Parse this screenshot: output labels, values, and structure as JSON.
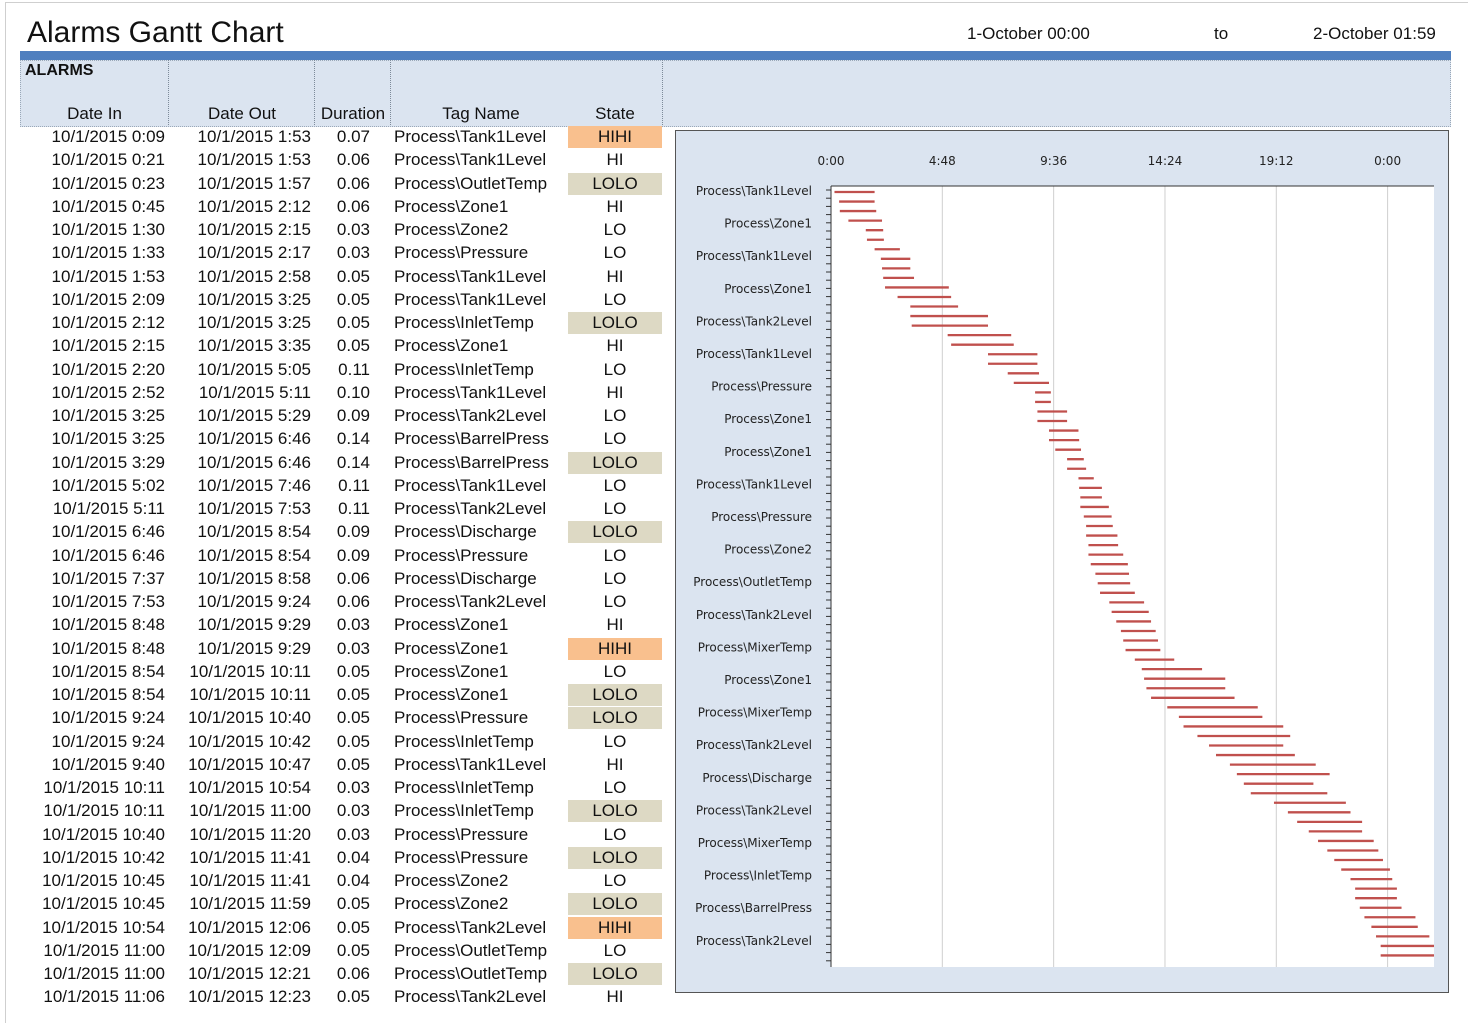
{
  "header": {
    "title": "Alarms Gantt Chart",
    "range_start": "1-October 00:00",
    "range_sep": "to",
    "range_end": "2-October 01:59"
  },
  "table": {
    "section_label": "ALARMS",
    "columns": [
      "Date In",
      "Date Out",
      "Duration",
      "Tag Name",
      "State"
    ],
    "state_colors": {
      "HIHI": "#f9c08e",
      "LOLO": "#ddd9c4",
      "HI": "#ffffff",
      "LO": "#ffffff"
    },
    "rows": [
      [
        "10/1/2015 0:09",
        "10/1/2015 1:53",
        "0.07",
        "Process\\Tank1Level",
        "HIHI"
      ],
      [
        "10/1/2015 0:21",
        "10/1/2015 1:53",
        "0.06",
        "Process\\Tank1Level",
        "HI"
      ],
      [
        "10/1/2015 0:23",
        "10/1/2015 1:57",
        "0.06",
        "Process\\OutletTemp",
        "LOLO"
      ],
      [
        "10/1/2015 0:45",
        "10/1/2015 2:12",
        "0.06",
        "Process\\Zone1",
        "HI"
      ],
      [
        "10/1/2015 1:30",
        "10/1/2015 2:15",
        "0.03",
        "Process\\Zone2",
        "LO"
      ],
      [
        "10/1/2015 1:33",
        "10/1/2015 2:17",
        "0.03",
        "Process\\Pressure",
        "LO"
      ],
      [
        "10/1/2015 1:53",
        "10/1/2015 2:58",
        "0.05",
        "Process\\Tank1Level",
        "HI"
      ],
      [
        "10/1/2015 2:09",
        "10/1/2015 3:25",
        "0.05",
        "Process\\Tank1Level",
        "LO"
      ],
      [
        "10/1/2015 2:12",
        "10/1/2015 3:25",
        "0.05",
        "Process\\InletTemp",
        "LOLO"
      ],
      [
        "10/1/2015 2:15",
        "10/1/2015 3:35",
        "0.05",
        "Process\\Zone1",
        "HI"
      ],
      [
        "10/1/2015 2:20",
        "10/1/2015 5:05",
        "0.11",
        "Process\\InletTemp",
        "LO"
      ],
      [
        "10/1/2015 2:52",
        "10/1/2015 5:11",
        "0.10",
        "Process\\Tank1Level",
        "HI"
      ],
      [
        "10/1/2015 3:25",
        "10/1/2015 5:29",
        "0.09",
        "Process\\Tank2Level",
        "LO"
      ],
      [
        "10/1/2015 3:25",
        "10/1/2015 6:46",
        "0.14",
        "Process\\BarrelPress",
        "LO"
      ],
      [
        "10/1/2015 3:29",
        "10/1/2015 6:46",
        "0.14",
        "Process\\BarrelPress",
        "LOLO"
      ],
      [
        "10/1/2015 5:02",
        "10/1/2015 7:46",
        "0.11",
        "Process\\Tank1Level",
        "LO"
      ],
      [
        "10/1/2015 5:11",
        "10/1/2015 7:53",
        "0.11",
        "Process\\Tank2Level",
        "LO"
      ],
      [
        "10/1/2015 6:46",
        "10/1/2015 8:54",
        "0.09",
        "Process\\Discharge",
        "LOLO"
      ],
      [
        "10/1/2015 6:46",
        "10/1/2015 8:54",
        "0.09",
        "Process\\Pressure",
        "LO"
      ],
      [
        "10/1/2015 7:37",
        "10/1/2015 8:58",
        "0.06",
        "Process\\Discharge",
        "LO"
      ],
      [
        "10/1/2015 7:53",
        "10/1/2015 9:24",
        "0.06",
        "Process\\Tank2Level",
        "LO"
      ],
      [
        "10/1/2015 8:48",
        "10/1/2015 9:29",
        "0.03",
        "Process\\Zone1",
        "HI"
      ],
      [
        "10/1/2015 8:48",
        "10/1/2015 9:29",
        "0.03",
        "Process\\Zone1",
        "HIHI"
      ],
      [
        "10/1/2015 8:54",
        "10/1/2015 10:11",
        "0.05",
        "Process\\Zone1",
        "LO"
      ],
      [
        "10/1/2015 8:54",
        "10/1/2015 10:11",
        "0.05",
        "Process\\Zone1",
        "LOLO"
      ],
      [
        "10/1/2015 9:24",
        "10/1/2015 10:40",
        "0.05",
        "Process\\Pressure",
        "LOLO"
      ],
      [
        "10/1/2015 9:24",
        "10/1/2015 10:42",
        "0.05",
        "Process\\InletTemp",
        "LO"
      ],
      [
        "10/1/2015 9:40",
        "10/1/2015 10:47",
        "0.05",
        "Process\\Tank1Level",
        "HI"
      ],
      [
        "10/1/2015 10:11",
        "10/1/2015 10:54",
        "0.03",
        "Process\\InletTemp",
        "LO"
      ],
      [
        "10/1/2015 10:11",
        "10/1/2015 11:00",
        "0.03",
        "Process\\InletTemp",
        "LOLO"
      ],
      [
        "10/1/2015 10:40",
        "10/1/2015 11:20",
        "0.03",
        "Process\\Pressure",
        "LO"
      ],
      [
        "10/1/2015 10:42",
        "10/1/2015 11:41",
        "0.04",
        "Process\\Pressure",
        "LOLO"
      ],
      [
        "10/1/2015 10:45",
        "10/1/2015 11:41",
        "0.04",
        "Process\\Zone2",
        "LO"
      ],
      [
        "10/1/2015 10:45",
        "10/1/2015 11:59",
        "0.05",
        "Process\\Zone2",
        "LOLO"
      ],
      [
        "10/1/2015 10:54",
        "10/1/2015 12:06",
        "0.05",
        "Process\\Tank2Level",
        "HIHI"
      ],
      [
        "10/1/2015 11:00",
        "10/1/2015 12:09",
        "0.05",
        "Process\\OutletTemp",
        "LO"
      ],
      [
        "10/1/2015 11:00",
        "10/1/2015 12:21",
        "0.06",
        "Process\\OutletTemp",
        "LOLO"
      ],
      [
        "10/1/2015 11:06",
        "10/1/2015 12:23",
        "0.05",
        "Process\\Tank2Level",
        "HI"
      ]
    ]
  },
  "chart_data": {
    "type": "gantt",
    "x_ticks": [
      "0:00",
      "4:48",
      "9:36",
      "14:24",
      "19:12",
      "0:00"
    ],
    "x_range_hours": [
      0,
      26
    ],
    "bar_color": "#c0504d",
    "y_labels": [
      "Process\\Tank1Level",
      "Process\\Zone1",
      "Process\\Tank1Level",
      "Process\\Zone1",
      "Process\\Tank2Level",
      "Process\\Tank1Level",
      "Process\\Pressure",
      "Process\\Zone1",
      "Process\\Zone1",
      "Process\\Tank1Level",
      "Process\\Pressure",
      "Process\\Zone2",
      "Process\\OutletTemp",
      "Process\\Tank2Level",
      "Process\\MixerTemp",
      "Process\\Zone1",
      "Process\\MixerTemp",
      "Process\\Tank2Level",
      "Process\\Discharge",
      "Process\\Tank2Level",
      "Process\\MixerTemp",
      "Process\\InletTemp",
      "Process\\BarrelPress",
      "Process\\Tank2Level"
    ],
    "bars_hours": [
      [
        0.15,
        1.88
      ],
      [
        0.35,
        1.88
      ],
      [
        0.38,
        1.95
      ],
      [
        0.75,
        2.2
      ],
      [
        1.5,
        2.25
      ],
      [
        1.55,
        2.28
      ],
      [
        1.88,
        2.97
      ],
      [
        2.15,
        3.42
      ],
      [
        2.2,
        3.42
      ],
      [
        2.25,
        3.58
      ],
      [
        2.33,
        5.08
      ],
      [
        2.87,
        5.18
      ],
      [
        3.42,
        5.48
      ],
      [
        3.42,
        6.77
      ],
      [
        3.48,
        6.77
      ],
      [
        5.03,
        7.77
      ],
      [
        5.18,
        7.88
      ],
      [
        6.77,
        8.9
      ],
      [
        6.77,
        8.9
      ],
      [
        7.62,
        8.97
      ],
      [
        7.88,
        9.4
      ],
      [
        8.8,
        9.48
      ],
      [
        8.8,
        9.48
      ],
      [
        8.9,
        10.18
      ],
      [
        8.9,
        10.18
      ],
      [
        9.4,
        10.67
      ],
      [
        9.4,
        10.7
      ],
      [
        9.67,
        10.78
      ],
      [
        10.18,
        10.9
      ],
      [
        10.18,
        11.0
      ],
      [
        10.67,
        11.33
      ],
      [
        10.7,
        11.68
      ],
      [
        10.75,
        11.68
      ],
      [
        10.75,
        11.98
      ],
      [
        10.9,
        12.1
      ],
      [
        11.0,
        12.15
      ],
      [
        11.0,
        12.35
      ],
      [
        11.1,
        12.38
      ],
      [
        11.1,
        12.6
      ],
      [
        11.2,
        12.8
      ],
      [
        11.4,
        12.85
      ],
      [
        11.5,
        12.9
      ],
      [
        11.6,
        13.1
      ],
      [
        12.0,
        13.5
      ],
      [
        12.1,
        13.7
      ],
      [
        12.3,
        13.8
      ],
      [
        12.5,
        14.0
      ],
      [
        12.6,
        14.1
      ],
      [
        12.7,
        14.2
      ],
      [
        13.1,
        14.8
      ],
      [
        13.4,
        16.0
      ],
      [
        13.5,
        17.0
      ],
      [
        13.6,
        17.0
      ],
      [
        13.8,
        17.4
      ],
      [
        14.5,
        18.4
      ],
      [
        15.0,
        18.6
      ],
      [
        15.2,
        19.5
      ],
      [
        15.8,
        19.8
      ],
      [
        16.3,
        19.5
      ],
      [
        16.6,
        20.0
      ],
      [
        17.2,
        20.9
      ],
      [
        17.5,
        21.5
      ],
      [
        17.8,
        20.8
      ],
      [
        18.1,
        21.4
      ],
      [
        19.1,
        22.2
      ],
      [
        19.7,
        22.4
      ],
      [
        20.1,
        22.9
      ],
      [
        20.6,
        22.9
      ],
      [
        21.0,
        23.4
      ],
      [
        21.4,
        23.6
      ],
      [
        21.7,
        23.8
      ],
      [
        22.0,
        24.1
      ],
      [
        22.4,
        24.2
      ],
      [
        22.6,
        24.4
      ],
      [
        22.6,
        24.4
      ],
      [
        22.8,
        24.6
      ],
      [
        23.0,
        25.2
      ],
      [
        23.3,
        25.3
      ],
      [
        23.5,
        25.8
      ],
      [
        23.7,
        26.0
      ],
      [
        23.7,
        26.0
      ]
    ]
  }
}
